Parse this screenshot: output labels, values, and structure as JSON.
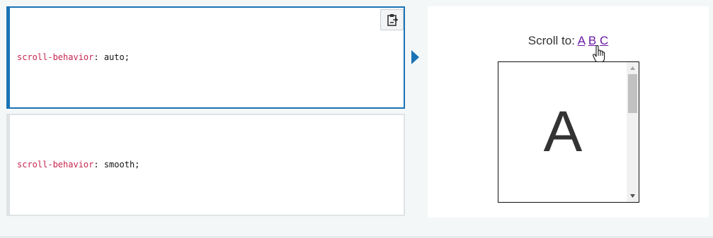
{
  "examples": [
    {
      "property": "scroll-behavior",
      "separator": ": ",
      "value": "auto;",
      "selected": true
    },
    {
      "property": "scroll-behavior",
      "separator": ": ",
      "value": "smooth;",
      "selected": false
    }
  ],
  "toolbar": {
    "copy_icon": "clipboard-icon"
  },
  "output": {
    "scroll_label": "Scroll to:",
    "links": [
      "A",
      "B",
      "C"
    ],
    "current_letter": "A",
    "scroll_position": 0.0
  },
  "colors": {
    "accent": "#1a73b5",
    "property": "#c7254e",
    "link": "#6a1aa6"
  }
}
